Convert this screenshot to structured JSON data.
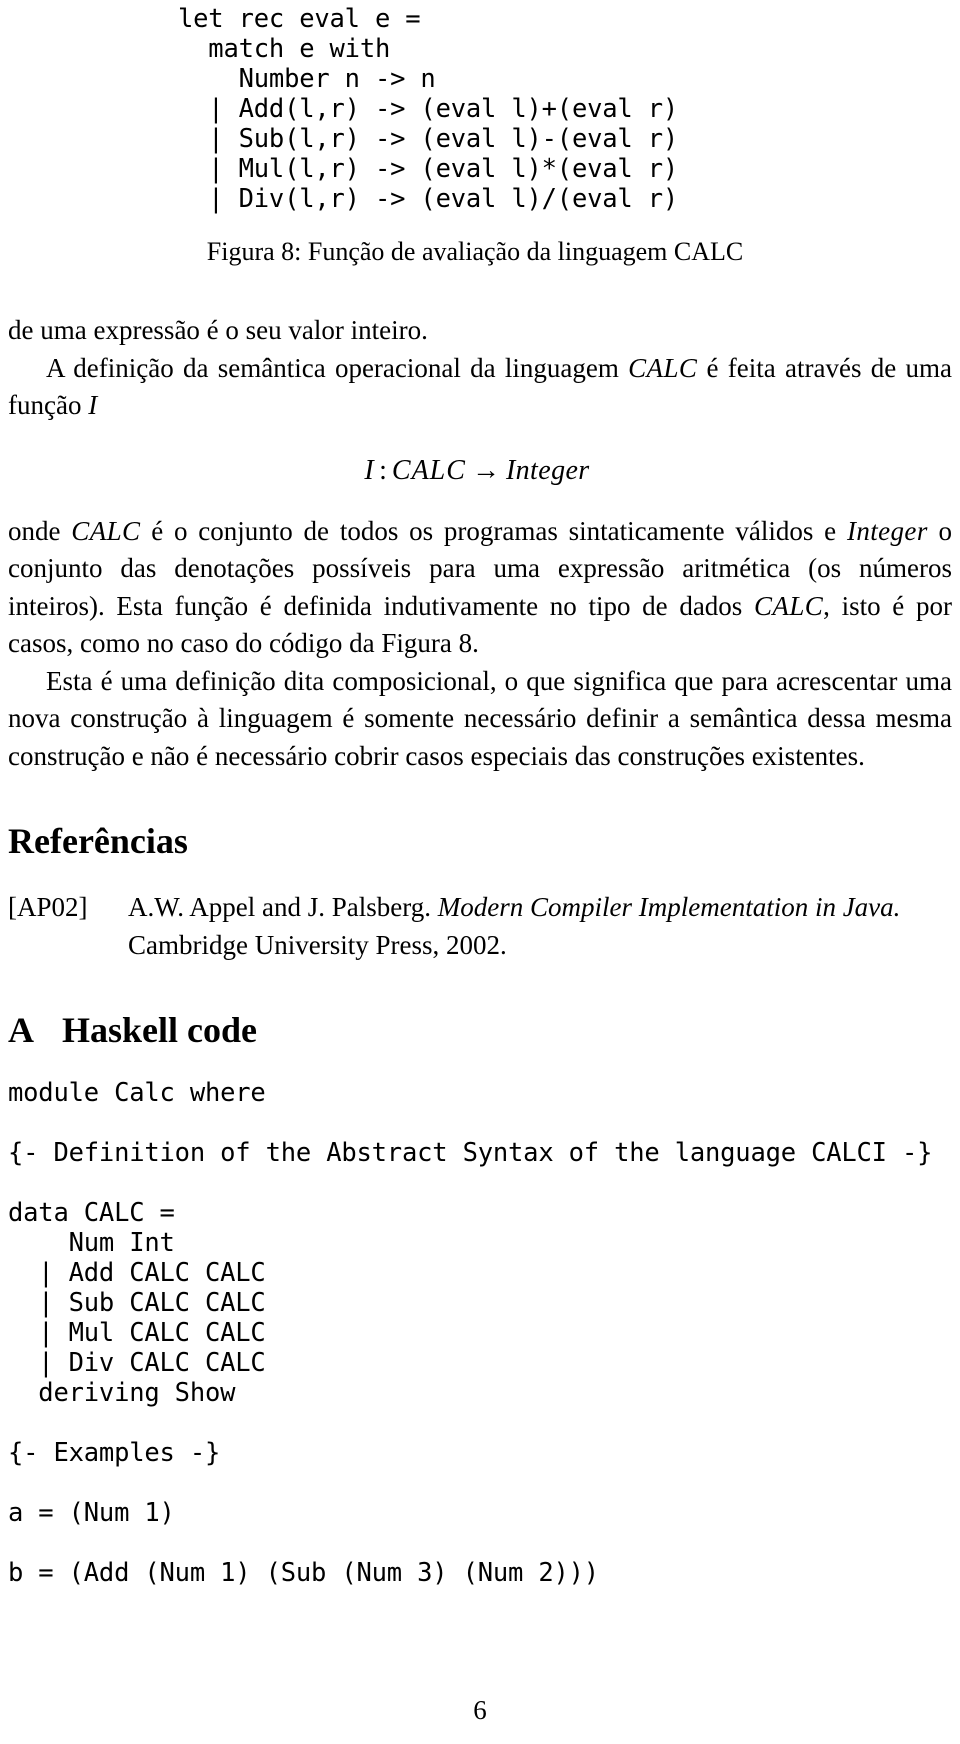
{
  "document": {
    "page_number": "6"
  },
  "figure": {
    "code": "let rec eval e =\n  match e with\n    Number n -> n\n  | Add(l,r) -> (eval l)+(eval r)\n  | Sub(l,r) -> (eval l)-(eval r)\n  | Mul(l,r) -> (eval l)*(eval r)\n  | Div(l,r) -> (eval l)/(eval r)",
    "caption": "Figura 8: Função de avaliação da linguagem CALC"
  },
  "body": {
    "para1": "de uma expressão é o seu valor inteiro.",
    "para2_a": "A definição da semântica operacional da linguagem ",
    "para2_math": "CALC",
    "para2_b": " é feita através de uma função ",
    "para2_math2": "I",
    "equation": {
      "lhs": "I",
      "colon": ":",
      "domain": "CALC",
      "arrow": "→",
      "codomain": "Integer"
    },
    "para3_a": "onde ",
    "para3_math1": "CALC",
    "para3_b": " é o conjunto de todos os programas sintaticamente válidos e ",
    "para3_math2": "Integer",
    "para3_c": " o conjunto das denotações possíveis para uma expressão aritmética (os números inteiros). Esta função é definida indutivamente no tipo de dados ",
    "para3_math3": "CALC",
    "para3_d": ", isto é por casos, como no caso do código da Figura 8.",
    "para4": "Esta é uma definição dita composicional, o que significa que para acrescentar uma nova construção à linguagem é somente necessário definir a semântica dessa mesma construção e não é necessário cobrir casos especiais das construções existentes."
  },
  "references": {
    "heading": "Referências",
    "items": [
      {
        "label": "[AP02]",
        "authors": "A.W. Appel and J. Palsberg. ",
        "title": "Modern Compiler Implementation in Java.",
        "publisher": " Cambridge University Press, 2002."
      }
    ]
  },
  "appendix": {
    "letter": "A",
    "title": "Haskell code",
    "code": "module Calc where\n\n{- Definition of the Abstract Syntax of the language CALCI -}\n\ndata CALC =\n    Num Int\n  | Add CALC CALC\n  | Sub CALC CALC\n  | Mul CALC CALC\n  | Div CALC CALC\n  deriving Show\n\n{- Examples -}\n\na = (Num 1)\n\nb = (Add (Num 1) (Sub (Num 3) (Num 2)))"
  }
}
